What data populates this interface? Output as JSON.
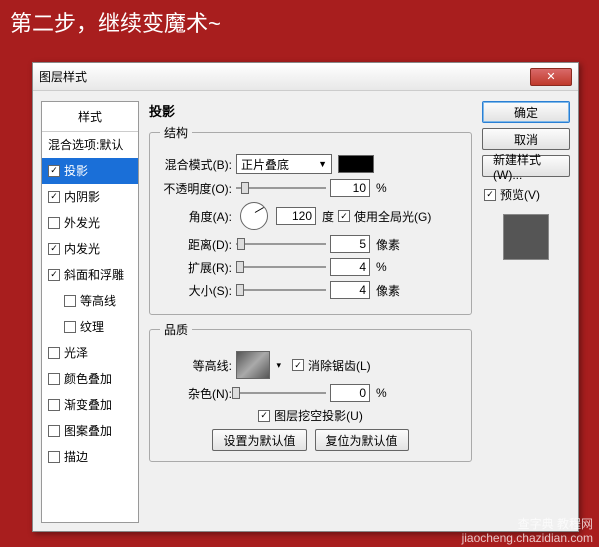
{
  "header_text": "第二步，继续变魔术~",
  "dialog": {
    "title": "图层样式"
  },
  "styles": {
    "header": "样式",
    "items": [
      {
        "label": "混合选项:默认",
        "type": "plain"
      },
      {
        "label": "投影",
        "checked": true,
        "selected": true
      },
      {
        "label": "内阴影",
        "checked": true
      },
      {
        "label": "外发光",
        "checked": false
      },
      {
        "label": "内发光",
        "checked": true
      },
      {
        "label": "斜面和浮雕",
        "checked": true
      },
      {
        "label": "等高线",
        "checked": false,
        "indent": true
      },
      {
        "label": "纹理",
        "checked": false,
        "indent": true
      },
      {
        "label": "光泽",
        "checked": false
      },
      {
        "label": "颜色叠加",
        "checked": false
      },
      {
        "label": "渐变叠加",
        "checked": false
      },
      {
        "label": "图案叠加",
        "checked": false
      },
      {
        "label": "描边",
        "checked": false
      }
    ]
  },
  "main": {
    "title": "投影",
    "structure_legend": "结构",
    "blend_mode_label": "混合模式(B):",
    "blend_mode_value": "正片叠底",
    "opacity_label": "不透明度(O):",
    "opacity_value": "10",
    "opacity_unit": "%",
    "angle_label": "角度(A):",
    "angle_value": "120",
    "angle_unit": "度",
    "global_light_label": "使用全局光(G)",
    "distance_label": "距离(D):",
    "distance_value": "5",
    "distance_unit": "像素",
    "spread_label": "扩展(R):",
    "spread_value": "4",
    "spread_unit": "%",
    "size_label": "大小(S):",
    "size_value": "4",
    "size_unit": "像素",
    "quality_legend": "品质",
    "contour_label": "等高线:",
    "antialias_label": "消除锯齿(L)",
    "noise_label": "杂色(N):",
    "noise_value": "0",
    "noise_unit": "%",
    "knockout_label": "图层挖空投影(U)",
    "set_default": "设置为默认值",
    "reset_default": "复位为默认值"
  },
  "right": {
    "ok": "确定",
    "cancel": "取消",
    "new_style": "新建样式(W)...",
    "preview": "预览(V)"
  },
  "watermark": {
    "line1": "查字典 教程网",
    "line2": "jiaocheng.chazidian.com"
  }
}
